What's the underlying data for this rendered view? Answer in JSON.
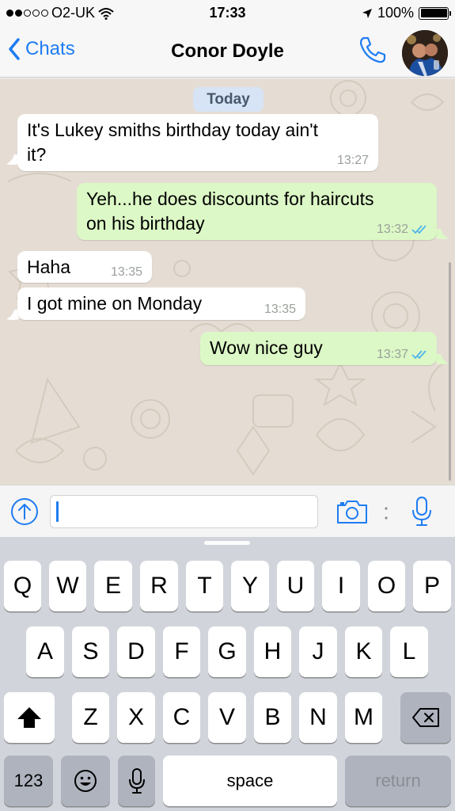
{
  "status_bar": {
    "carrier": "O2-UK",
    "time": "17:33",
    "battery": "100%",
    "signal_bars_filled": 2,
    "signal_bars_total": 5
  },
  "nav": {
    "back_label": "Chats",
    "title": "Conor Doyle"
  },
  "chat": {
    "date_label": "Today",
    "messages": [
      {
        "direction": "in",
        "text_line1": "It's Lukey smiths birthday today ain't",
        "text_line2": "it?",
        "time": "13:27"
      },
      {
        "direction": "out",
        "text_line1": "Yeh...he does discounts for haircuts",
        "text_line2": "on his birthday",
        "time": "13:32",
        "status": "read"
      },
      {
        "direction": "in",
        "text": "Haha",
        "time": "13:35"
      },
      {
        "direction": "in",
        "text": "I got mine on Monday",
        "time": "13:35"
      },
      {
        "direction": "out",
        "text": "Wow nice guy",
        "time": "13:37",
        "status": "read"
      }
    ]
  },
  "input": {
    "value": ""
  },
  "keyboard": {
    "row1": [
      "Q",
      "W",
      "E",
      "R",
      "T",
      "Y",
      "U",
      "I",
      "O",
      "P"
    ],
    "row2": [
      "A",
      "S",
      "D",
      "F",
      "G",
      "H",
      "J",
      "K",
      "L"
    ],
    "row3": [
      "Z",
      "X",
      "C",
      "V",
      "B",
      "N",
      "M"
    ],
    "numbers_label": "123",
    "space_label": "space",
    "return_label": "return"
  },
  "colors": {
    "accent": "#1e7cf2",
    "outgoing_bubble": "#dcf8c6",
    "incoming_bubble": "#ffffff",
    "chat_background": "#e5ddd4",
    "read_ticks": "#4fb6ec"
  },
  "icons": [
    "back-chevron-icon",
    "phone-icon",
    "attach-arrow-icon",
    "camera-icon",
    "microphone-icon",
    "shift-icon",
    "delete-icon",
    "emoji-icon",
    "dictation-icon",
    "location-arrow-icon",
    "wifi-icon",
    "battery-icon"
  ]
}
